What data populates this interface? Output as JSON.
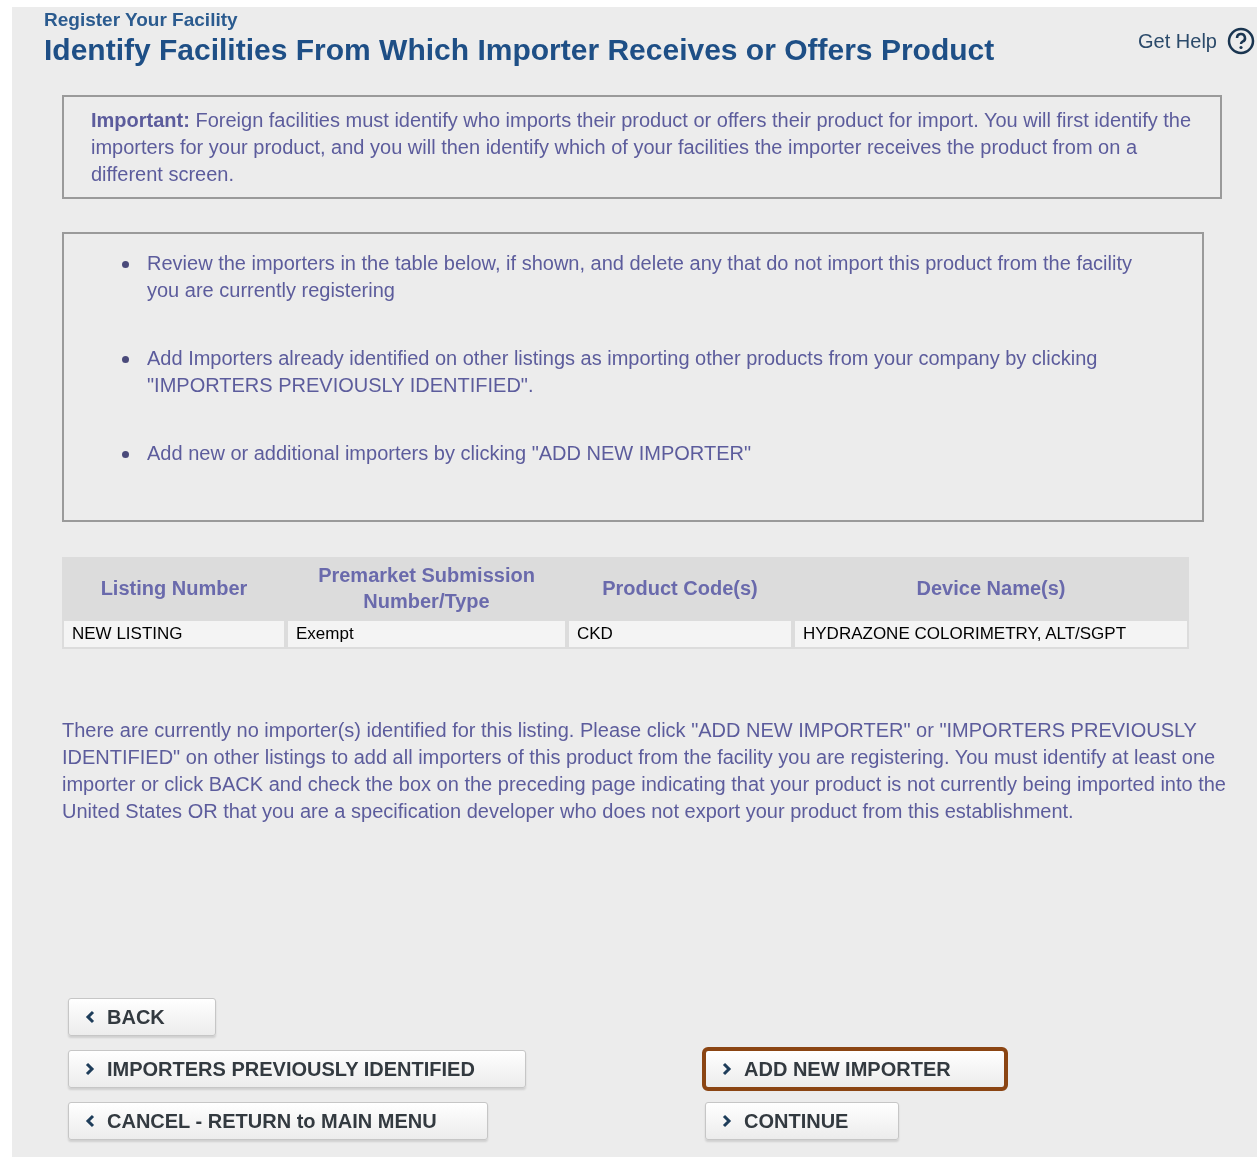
{
  "header": {
    "breadcrumb": "Register Your Facility",
    "title": "Identify Facilities From Which Importer Receives or Offers Product",
    "help": "Get Help"
  },
  "notice": "**Important:** Foreign facilities must identify who imports their product or offers their product for import. You will first identify the importers for your product, and you will then identify which of your facilities the importer receives the product from on a different screen.",
  "instructions": [
    "Review the importers in the table below, if shown, and delete any that do not import this product from the facility you are currently registering",
    "Add Importers already identified on other listings as importing other products from your company by clicking \"IMPORTERS PREVIOUSLY IDENTIFIED\".",
    "Add new or additional importers by clicking \"ADD NEW IMPORTER\""
  ],
  "table": {
    "columns": [
      "Listing Number",
      "Premarket Submission Number/Type",
      "Product Code(s)",
      "Device Name(s)"
    ],
    "rows": [
      [
        "NEW LISTING",
        "Exempt",
        "CKD",
        "HYDRAZONE COLORIMETRY, ALT/SGPT"
      ]
    ]
  },
  "message": "There are currently no importer(s) identified for this listing. Please click \"ADD NEW IMPORTER\" or \"IMPORTERS PREVIOUSLY IDENTIFIED\" on other listings to add all importers of this product from the facility you are registering. You must identify at least one importer or click BACK and check the box on the preceding page indicating that your product is not currently being imported into the United States OR that you are a specification developer who does not export your product from this establishment.",
  "button_rows": [
    [
      {
        "label": "BACK",
        "kind": "back",
        "highlighted": false
      }
    ],
    [
      {
        "label": "IMPORTERS PREVIOUSLY IDENTIFIED",
        "kind": "forward",
        "highlighted": false
      },
      {
        "label": "ADD NEW IMPORTER",
        "kind": "forward",
        "highlighted": true
      }
    ],
    [
      {
        "label": "CANCEL - RETURN to MAIN MENU",
        "kind": "back",
        "highlighted": false
      },
      {
        "label": "CONTINUE",
        "kind": "forward",
        "highlighted": false
      }
    ]
  ]
}
